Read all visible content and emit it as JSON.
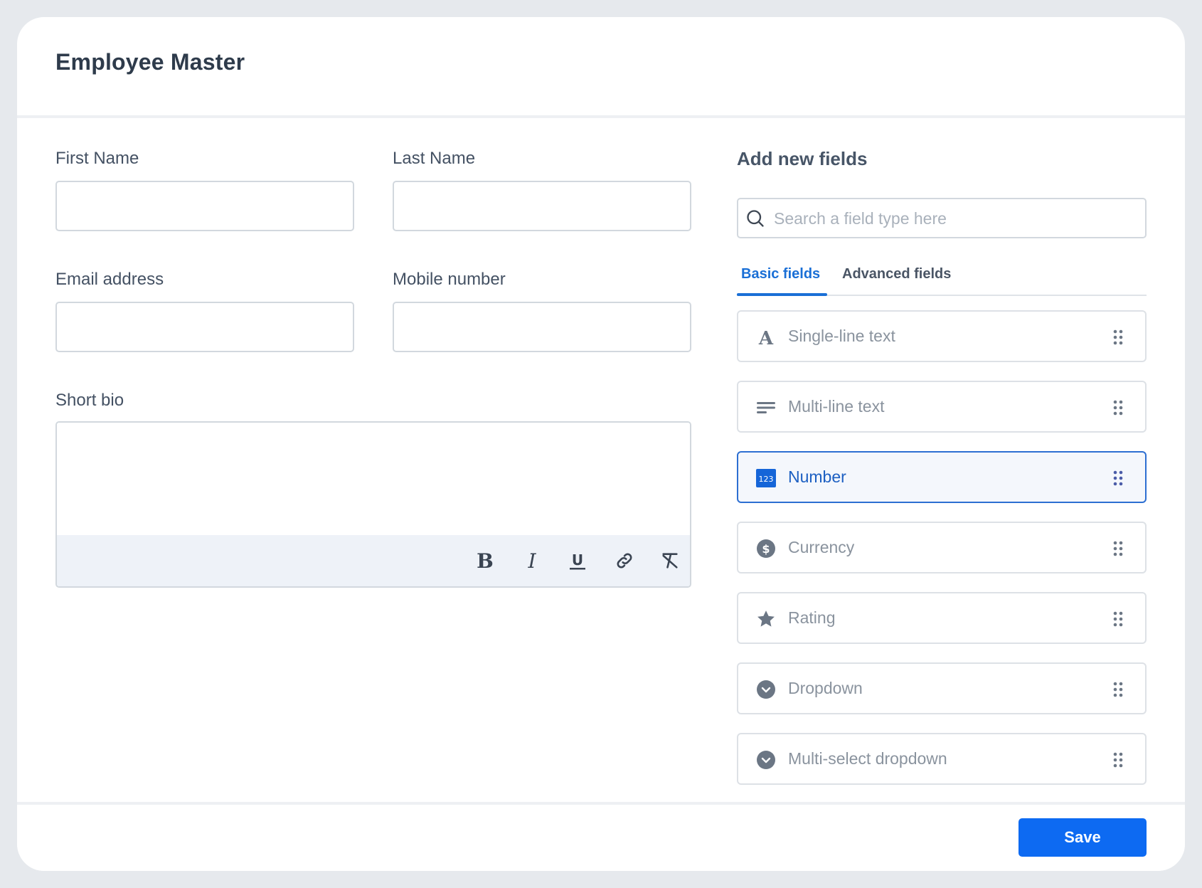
{
  "page": {
    "title": "Employee Master"
  },
  "form": {
    "first_name": {
      "label": "First Name",
      "value": ""
    },
    "last_name": {
      "label": "Last Name",
      "value": ""
    },
    "email": {
      "label": "Email address",
      "value": ""
    },
    "mobile": {
      "label": "Mobile number",
      "value": ""
    },
    "bio": {
      "label": "Short bio",
      "value": ""
    },
    "toolbar": [
      "bold-icon",
      "italic-icon",
      "underline-icon",
      "link-icon",
      "clear-format-icon"
    ]
  },
  "panel": {
    "title": "Add new fields",
    "search_placeholder": "Search a field type here",
    "tabs": [
      {
        "label": "Basic fields",
        "active": true
      },
      {
        "label": "Advanced fields",
        "active": false
      }
    ],
    "fields": [
      {
        "label": "Single-line text",
        "icon": "letter-a-icon"
      },
      {
        "label": "Multi-line text",
        "icon": "lines-icon"
      },
      {
        "label": "Number",
        "icon": "number-123-icon",
        "selected": true
      },
      {
        "label": "Currency",
        "icon": "dollar-icon"
      },
      {
        "label": "Rating",
        "icon": "star-icon"
      },
      {
        "label": "Dropdown",
        "icon": "chevron-circle-icon"
      },
      {
        "label": "Multi-select dropdown",
        "icon": "chevron-circle-icon"
      }
    ],
    "selected_field_color": "#2d6fd2"
  },
  "footer": {
    "save_label": "Save",
    "save_color": "#0d6af2"
  }
}
